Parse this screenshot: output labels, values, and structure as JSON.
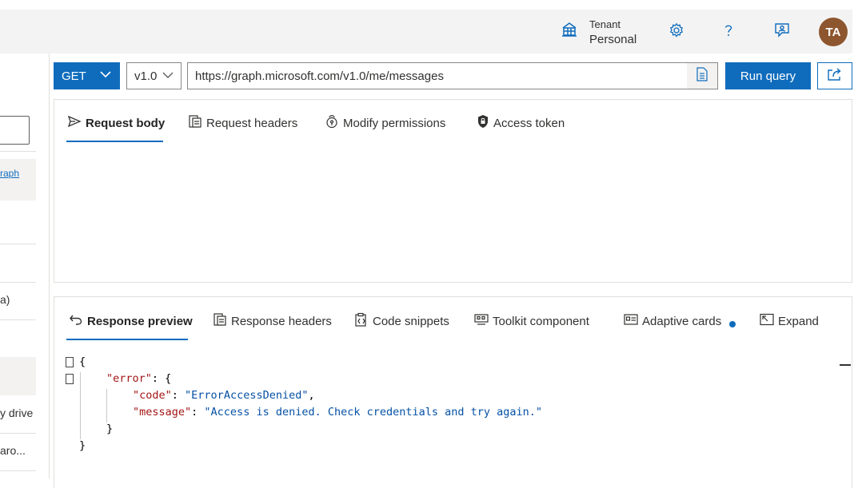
{
  "header": {
    "tenant_label": "Tenant",
    "tenant_value": "Personal",
    "avatar_initials": "TA",
    "icons": [
      "tenant-globe-icon",
      "settings-gear-icon",
      "help-icon",
      "feedback-icon"
    ]
  },
  "sidebar": {
    "link_text": "raph",
    "items": [
      "a)",
      "y drive",
      " aro..."
    ]
  },
  "query": {
    "method": "GET",
    "version": "v1.0",
    "url": "https://graph.microsoft.com/v1.0/me/messages",
    "run_label": "Run query"
  },
  "request_tabs": [
    {
      "label": "Request body",
      "icon": "send-icon"
    },
    {
      "label": "Request headers",
      "icon": "headers-icon"
    },
    {
      "label": "Modify permissions",
      "icon": "permissions-icon"
    },
    {
      "label": "Access token",
      "icon": "lock-icon"
    }
  ],
  "response_tabs": [
    {
      "label": "Response preview",
      "icon": "undo-arrow-icon"
    },
    {
      "label": "Response headers",
      "icon": "headers-icon"
    },
    {
      "label": "Code snippets",
      "icon": "clipboard-code-icon"
    },
    {
      "label": "Toolkit component",
      "icon": "toolkit-icon"
    },
    {
      "label": "Adaptive cards",
      "icon": "card-icon"
    },
    {
      "label": "Expand",
      "icon": "expand-icon"
    }
  ],
  "response": {
    "open_brace": "{",
    "error_key": "\"error\"",
    "code_key": "\"code\"",
    "code_value": "\"ErrorAccessDenied\"",
    "message_key": "\"message\"",
    "message_value": "\"Access is denied. Check credentials and try again.\"",
    "close_inner": "}",
    "close_outer": "}"
  },
  "colors": {
    "accent": "#0f6cbd",
    "avatar": "#8e562e",
    "json_key": "#a31515",
    "json_string": "#0451a5"
  }
}
